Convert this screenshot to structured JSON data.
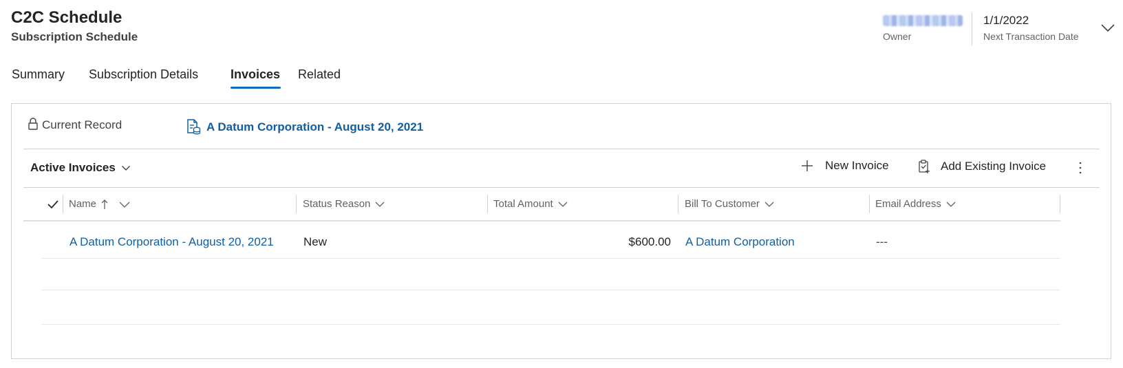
{
  "header": {
    "title": "C2C Schedule",
    "subtitle": "Subscription Schedule",
    "owner_label": "Owner",
    "next_transaction_date": "1/1/2022",
    "next_transaction_date_label": "Next Transaction Date"
  },
  "tabs": [
    {
      "label": "Summary",
      "active": false
    },
    {
      "label": "Subscription Details",
      "active": false
    },
    {
      "label": "Invoices",
      "active": true
    },
    {
      "label": "Related",
      "active": false
    }
  ],
  "panel": {
    "current_record_label": "Current Record",
    "current_record_value": "A Datum Corporation - August 20, 2021",
    "view_name": "Active Invoices",
    "commands": {
      "new_invoice": "New Invoice",
      "add_existing_invoice": "Add Existing Invoice"
    },
    "columns": [
      "Name",
      "Status Reason",
      "Total Amount",
      "Bill To Customer",
      "Email Address"
    ],
    "sort": {
      "column": "Name",
      "direction": "ascending"
    },
    "rows": [
      {
        "name": "A Datum Corporation - August 20, 2021",
        "status_reason": "New",
        "total_amount": "$600.00",
        "bill_to_customer": "A Datum Corporation",
        "email_address": "---"
      }
    ]
  },
  "colors": {
    "accent": "#0f6cbd",
    "link": "#115ea3",
    "text": "#242424",
    "muted": "#616161",
    "border": "#d1d1d1"
  },
  "icons": [
    "lock-icon",
    "record-icon",
    "chevron-down-icon",
    "plus-icon",
    "add-existing-icon",
    "more-vertical-icon",
    "checkmark-icon",
    "sort-up-icon"
  ]
}
